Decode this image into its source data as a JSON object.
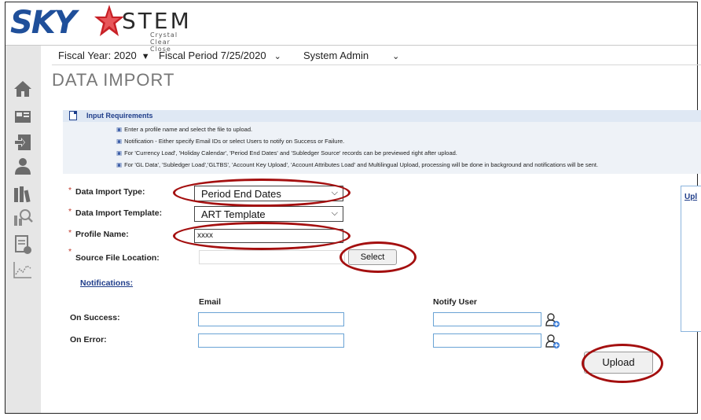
{
  "logo": {
    "sky": "SKY",
    "stem": "STEM",
    "tagline": "Crystal Clear Close"
  },
  "fiscal": {
    "year_label": "Fiscal Year: 2020",
    "period_label": "Fiscal Period",
    "period_value": "7/25/2020",
    "role": "System Admin"
  },
  "page_title": "DATA IMPORT",
  "requirements": {
    "title": "Input Requirements",
    "bullets": [
      "Enter a profile name and select the file to upload.",
      "Notification - Either specify Email IDs or select Users to notify on Success or Failure.",
      "For 'Currency Load', 'Holiday Calendar', 'Period End Dates' and 'Subledger Source' records can be previewed right after upload.",
      "For 'GL Data', 'Subledger Load','GLTBS', 'Account Key Upload', 'Account Attributes Load' and Multilingual Upload, processing will be done in background and notifications will be sent."
    ]
  },
  "form": {
    "import_type_label": "Data Import Type:",
    "import_type_value": "Period End Dates",
    "template_label": "Data Import Template:",
    "template_value": "ART Template",
    "profile_label": "Profile Name:",
    "profile_value": "xxxx",
    "source_label": "Source File Location:",
    "select_button": "Select"
  },
  "notifications": {
    "title": "Notifications:",
    "email_header": "Email",
    "notify_header": "Notify User",
    "on_success": "On Success:",
    "on_error": "On Error:"
  },
  "upload_button": "Upload",
  "right_panel_label": "Upl",
  "colors": {
    "accent": "#1f3d8a",
    "highlight_ring": "#a40f0f",
    "required": "#c0392b"
  }
}
